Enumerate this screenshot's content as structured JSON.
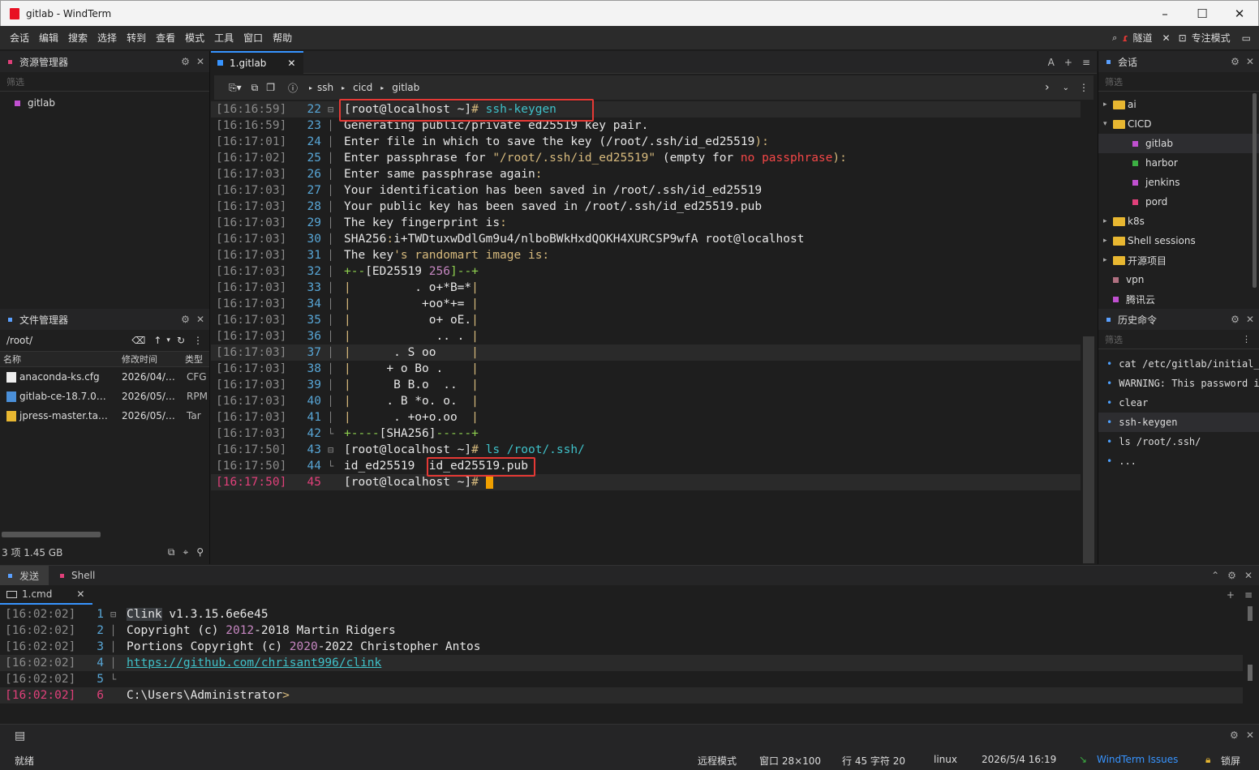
{
  "window": {
    "title": "gitlab - WindTerm",
    "minimize": "–",
    "maximize": "☐",
    "close": "✕"
  },
  "menu": {
    "items": [
      "会话",
      "编辑",
      "搜索",
      "选择",
      "转到",
      "查看",
      "模式",
      "工具",
      "窗口",
      "帮助"
    ],
    "tunnel": "隧道",
    "focus": "专注模式"
  },
  "explorer": {
    "title": "资源管理器",
    "filter": "筛选",
    "items": [
      {
        "label": "gitlab",
        "color": "#c050d0"
      }
    ]
  },
  "filemgr": {
    "title": "文件管理器",
    "path": "/root/",
    "columns": [
      "名称",
      "修改时间",
      "类型"
    ],
    "rows": [
      {
        "name": "anaconda-ks.cfg",
        "date": "2026/04/…",
        "type": "CFG"
      },
      {
        "name": "gitlab-ce-18.7.0…",
        "date": "2026/05/…",
        "type": "RPM"
      },
      {
        "name": "jpress-master.ta…",
        "date": "2026/05/…",
        "type": "Tar"
      }
    ],
    "summary": "3 项 1.45 GB"
  },
  "tab": {
    "label": "1.gitlab",
    "close": "✕"
  },
  "breadcrumb": [
    "ssh",
    "cicd",
    "gitlab"
  ],
  "terminal": {
    "lines": [
      {
        "ts": "[16:16:59]",
        "ln": "22",
        "fold": "⊟",
        "segs": [
          [
            "[root@localhost ~]",
            ""
          ],
          [
            "# ",
            "y"
          ],
          [
            "ssh-keygen",
            "c"
          ]
        ]
      },
      {
        "ts": "[16:16:59]",
        "ln": "23",
        "fold": "│",
        "segs": [
          [
            "Generating public/private ed25519 key pair.",
            ""
          ]
        ]
      },
      {
        "ts": "[16:17:01]",
        "ln": "24",
        "fold": "│",
        "segs": [
          [
            "Enter file in which to save the key ",
            ""
          ],
          [
            "(",
            ""
          ],
          [
            "/root/.ssh/id_ed25519",
            ""
          ],
          [
            "):",
            "y"
          ]
        ]
      },
      {
        "ts": "[16:17:02]",
        "ln": "25",
        "fold": "│",
        "segs": [
          [
            "Enter passphrase for ",
            ""
          ],
          [
            "\"/root/.ssh/id_ed25519\"",
            "y"
          ],
          [
            " (empty for ",
            ""
          ],
          [
            "no passphrase",
            "r"
          ],
          [
            "):",
            "y"
          ]
        ]
      },
      {
        "ts": "[16:17:03]",
        "ln": "26",
        "fold": "│",
        "segs": [
          [
            "Enter same passphrase again",
            ""
          ],
          [
            ":",
            "y"
          ]
        ]
      },
      {
        "ts": "[16:17:03]",
        "ln": "27",
        "fold": "│",
        "segs": [
          [
            "Your identification has been saved in /root/.ssh/id_ed25519",
            ""
          ]
        ]
      },
      {
        "ts": "[16:17:03]",
        "ln": "28",
        "fold": "│",
        "segs": [
          [
            "Your public key has been saved in /root/.ssh/id_ed25519.pub",
            ""
          ]
        ]
      },
      {
        "ts": "[16:17:03]",
        "ln": "29",
        "fold": "│",
        "segs": [
          [
            "The key fingerprint is",
            ""
          ],
          [
            ":",
            "y"
          ]
        ]
      },
      {
        "ts": "[16:17:03]",
        "ln": "30",
        "fold": "│",
        "segs": [
          [
            "SHA256",
            ""
          ],
          [
            ":",
            "y"
          ],
          [
            "i+TWDtuxwDdlGm9u4/nlboBWkHxdQOKH4XURCSP9wfA root@localhost",
            ""
          ]
        ]
      },
      {
        "ts": "[16:17:03]",
        "ln": "31",
        "fold": "│",
        "segs": [
          [
            "The key",
            ""
          ],
          [
            "'s randomart image is:",
            "y"
          ]
        ]
      },
      {
        "ts": "[16:17:03]",
        "ln": "32",
        "fold": "│",
        "segs": [
          [
            "+--",
            "g"
          ],
          [
            "[ED25519 ",
            ""
          ],
          [
            "256",
            "p"
          ],
          [
            "]--+",
            "g"
          ]
        ]
      },
      {
        "ts": "[16:17:03]",
        "ln": "33",
        "fold": "│",
        "segs": [
          [
            "|",
            "y"
          ],
          [
            "         . o+*B=*",
            ""
          ],
          [
            "|",
            "y"
          ]
        ]
      },
      {
        "ts": "[16:17:03]",
        "ln": "34",
        "fold": "│",
        "segs": [
          [
            "|",
            "y"
          ],
          [
            "          +oo*+= ",
            ""
          ],
          [
            "|",
            "y"
          ]
        ]
      },
      {
        "ts": "[16:17:03]",
        "ln": "35",
        "fold": "│",
        "segs": [
          [
            "|",
            "y"
          ],
          [
            "           o+ oE.",
            ""
          ],
          [
            "|",
            "y"
          ]
        ]
      },
      {
        "ts": "[16:17:03]",
        "ln": "36",
        "fold": "│",
        "segs": [
          [
            "|",
            "y"
          ],
          [
            "            .. . ",
            ""
          ],
          [
            "|",
            "y"
          ]
        ]
      },
      {
        "ts": "[16:17:03]",
        "ln": "37",
        "fold": "│",
        "segs": [
          [
            "|",
            "y"
          ],
          [
            "      . S oo     ",
            ""
          ],
          [
            "|",
            "y"
          ]
        ]
      },
      {
        "ts": "[16:17:03]",
        "ln": "38",
        "fold": "│",
        "segs": [
          [
            "|",
            "y"
          ],
          [
            "     + o Bo .    ",
            ""
          ],
          [
            "|",
            "y"
          ]
        ]
      },
      {
        "ts": "[16:17:03]",
        "ln": "39",
        "fold": "│",
        "segs": [
          [
            "|",
            "y"
          ],
          [
            "      B B.o  ..  ",
            ""
          ],
          [
            "|",
            "y"
          ]
        ]
      },
      {
        "ts": "[16:17:03]",
        "ln": "40",
        "fold": "│",
        "segs": [
          [
            "|",
            "y"
          ],
          [
            "     . B *o. o.  ",
            ""
          ],
          [
            "|",
            "y"
          ]
        ]
      },
      {
        "ts": "[16:17:03]",
        "ln": "41",
        "fold": "│",
        "segs": [
          [
            "|",
            "y"
          ],
          [
            "      . +o+o.oo  ",
            ""
          ],
          [
            "|",
            "y"
          ]
        ]
      },
      {
        "ts": "[16:17:03]",
        "ln": "42",
        "fold": "└",
        "segs": [
          [
            "+----",
            "g"
          ],
          [
            "[SHA256]",
            ""
          ],
          [
            "-----+",
            "g"
          ]
        ]
      },
      {
        "ts": "[16:17:50]",
        "ln": "43",
        "fold": "⊟",
        "segs": [
          [
            "[root@localhost ~]",
            ""
          ],
          [
            "# ",
            "y"
          ],
          [
            "ls /root/.ssh/",
            "c"
          ]
        ]
      },
      {
        "ts": "[16:17:50]",
        "ln": "44",
        "fold": "└",
        "segs": [
          [
            "id_ed25519  id_ed25519.pub",
            ""
          ]
        ]
      },
      {
        "ts": "[16:17:50]",
        "ln": "45",
        "fold": "",
        "segs": [
          [
            "[root@localhost ~]",
            ""
          ],
          [
            "# ",
            "y"
          ]
        ]
      }
    ]
  },
  "sessions": {
    "title": "会话",
    "filter": "筛选",
    "tree": [
      {
        "label": "ai",
        "type": "folder",
        "arrow": "▸",
        "indent": 0
      },
      {
        "label": "CICD",
        "type": "folder",
        "arrow": "▾",
        "indent": 0
      },
      {
        "label": "gitlab",
        "type": "item",
        "color": "#c050d0",
        "indent": 1
      },
      {
        "label": "harbor",
        "type": "item",
        "color": "#3cb043",
        "indent": 1
      },
      {
        "label": "jenkins",
        "type": "item",
        "color": "#c050d0",
        "indent": 1
      },
      {
        "label": "pord",
        "type": "item",
        "color": "#e0407a",
        "indent": 1
      },
      {
        "label": "k8s",
        "type": "folder",
        "arrow": "▸",
        "indent": 0
      },
      {
        "label": "Shell sessions",
        "type": "folder",
        "arrow": "▸",
        "indent": 0
      },
      {
        "label": "开源项目",
        "type": "folder",
        "arrow": "▸",
        "indent": 0
      },
      {
        "label": "vpn",
        "type": "item",
        "color": "#b07080",
        "indent": 0
      },
      {
        "label": "腾讯云",
        "type": "item",
        "color": "#c050d0",
        "indent": 0
      }
    ]
  },
  "history": {
    "title": "历史命令",
    "filter": "筛选",
    "items": [
      "cat /etc/gitlab/initial_root_password",
      "WARNING: This password is",
      "clear",
      "ssh-keygen",
      "ls /root/.ssh/",
      "..."
    ]
  },
  "bottom": {
    "tabs": [
      "发送",
      "Shell"
    ],
    "subtab": "1.cmd",
    "lines": [
      {
        "ts": "[16:02:02]",
        "ln": "1",
        "segs": [
          [
            "Clink",
            "hlw"
          ],
          [
            " v1.3.15.6e6e45",
            ""
          ]
        ]
      },
      {
        "ts": "[16:02:02]",
        "ln": "2",
        "segs": [
          [
            "Copyright ",
            ""
          ],
          [
            "(c) ",
            ""
          ],
          [
            "2012",
            "p"
          ],
          [
            "-2018 Martin Ridgers",
            ""
          ]
        ]
      },
      {
        "ts": "[16:02:02]",
        "ln": "3",
        "segs": [
          [
            "Portions Copyright ",
            ""
          ],
          [
            "(c) ",
            ""
          ],
          [
            "2020",
            "p"
          ],
          [
            "-2022 Christopher Antos",
            ""
          ]
        ]
      },
      {
        "ts": "[16:02:02]",
        "ln": "4",
        "segs": [
          [
            "https://github.com/chrisant996/clink",
            "link"
          ]
        ]
      },
      {
        "ts": "[16:02:02]",
        "ln": "5",
        "segs": []
      },
      {
        "ts": "[16:02:02]",
        "ln": "6",
        "segs": [
          [
            "C:\\Users\\Administrator",
            ""
          ],
          [
            ">",
            "y"
          ]
        ]
      }
    ]
  },
  "status": {
    "ready": "就绪",
    "mode": "远程模式",
    "window": "窗口 28×100",
    "pos": "行 45 字符 20",
    "os": "linux",
    "datetime": "2026/5/4 16:19",
    "issues": "WindTerm Issues",
    "lock": "锁屏"
  },
  "colors": {
    "accent": "#3794ff",
    "highlight_box": "#e53935",
    "prompt_hash": "#d7ba7d",
    "command": "#3fc1c9"
  }
}
